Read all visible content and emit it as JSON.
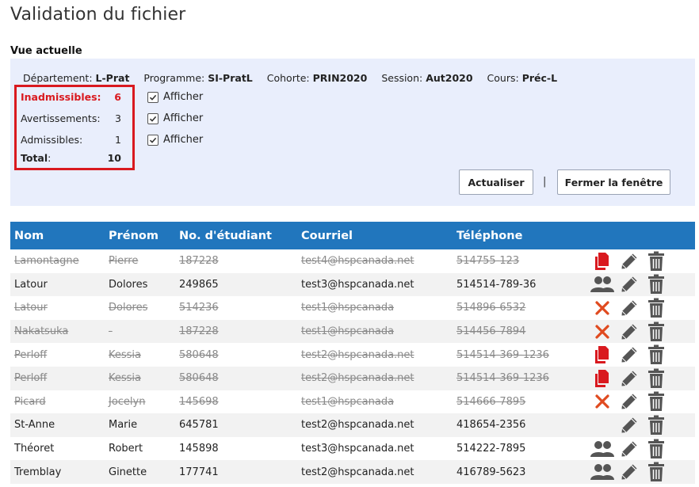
{
  "page": {
    "title": "Validation du fichier",
    "view_heading": "Vue actuelle"
  },
  "meta": {
    "departement_label": "Département:",
    "departement": "L-Prat",
    "programme_label": "Programme:",
    "programme": "SI-PratL",
    "cohorte_label": "Cohorte:",
    "cohorte": "PRIN2020",
    "session_label": "Session:",
    "session": "Aut2020",
    "cours_label": "Cours:",
    "cours": "Préc-L"
  },
  "stats": {
    "inadmissibles_label": "Inadmissibles:",
    "inadmissibles": "6",
    "avertissements_label": "Avertissements:",
    "avertissements": "3",
    "admissibles_label": "Admissibles:",
    "admissibles": "1",
    "total_label": "Total",
    "total_colon": ":",
    "total": "10"
  },
  "checkboxes": [
    {
      "label": "Afficher",
      "checked": true
    },
    {
      "label": "Afficher",
      "checked": true
    },
    {
      "label": "Afficher",
      "checked": true
    }
  ],
  "buttons": {
    "refresh": "Actualiser",
    "separator": "|",
    "close": "Fermer la fenêtre"
  },
  "table": {
    "headers": [
      "Nom",
      "Prénom",
      "No. d'étudiant",
      "Courriel",
      "Téléphone"
    ],
    "rows": [
      {
        "nom": "Lamontagne",
        "prenom": "Pierre",
        "no": "187228",
        "courriel": "test4@hspcanada.net",
        "tel": "514755-123",
        "struck": true,
        "status": "copy-icon"
      },
      {
        "nom": "Latour",
        "prenom": "Dolores",
        "no": "249865",
        "courriel": "test3@hspcanada.net",
        "tel": "514514-789-36",
        "struck": false,
        "status": "users-icon"
      },
      {
        "nom": "Latour",
        "prenom": "Dolores",
        "no": "514236",
        "courriel": "test1@hspcanada",
        "tel": "514896-6532",
        "struck": true,
        "status": "x-icon"
      },
      {
        "nom": "Nakatsuka",
        "prenom": "-",
        "no": "187228",
        "courriel": "test1@hspcanada",
        "tel": "514456-7894",
        "struck": true,
        "status": "x-icon"
      },
      {
        "nom": "Perloff",
        "prenom": "Kessia",
        "no": "580648",
        "courriel": "test2@hspcanada.net",
        "tel": "514514-369-1236",
        "struck": true,
        "status": "copy-icon"
      },
      {
        "nom": "Perloff",
        "prenom": "Kessia",
        "no": "580648",
        "courriel": "test2@hspcanada.net",
        "tel": "514514-369-1236",
        "struck": true,
        "status": "copy-icon"
      },
      {
        "nom": "Picard",
        "prenom": "Jocelyn",
        "no": "145698",
        "courriel": "test1@hspcanada",
        "tel": "514666-7895",
        "struck": true,
        "status": "x-icon"
      },
      {
        "nom": "St-Anne",
        "prenom": "Marie",
        "no": "645781",
        "courriel": "test2@hspcanada.net",
        "tel": "418654-2356",
        "struck": false,
        "status": ""
      },
      {
        "nom": "Théoret",
        "prenom": "Robert",
        "no": "145898",
        "courriel": "test3@hspcanada.net",
        "tel": "514222-7895",
        "struck": false,
        "status": "users-icon"
      },
      {
        "nom": "Tremblay",
        "prenom": "Ginette",
        "no": "177741",
        "courriel": "test2@hspcanada.net",
        "tel": "416789-5623",
        "struck": false,
        "status": "users-icon"
      }
    ]
  },
  "colors": {
    "header_blue": "#2176bd",
    "panel_bg": "#e9eefc",
    "alert_red": "#d9191f",
    "icon_dark": "#555555"
  }
}
